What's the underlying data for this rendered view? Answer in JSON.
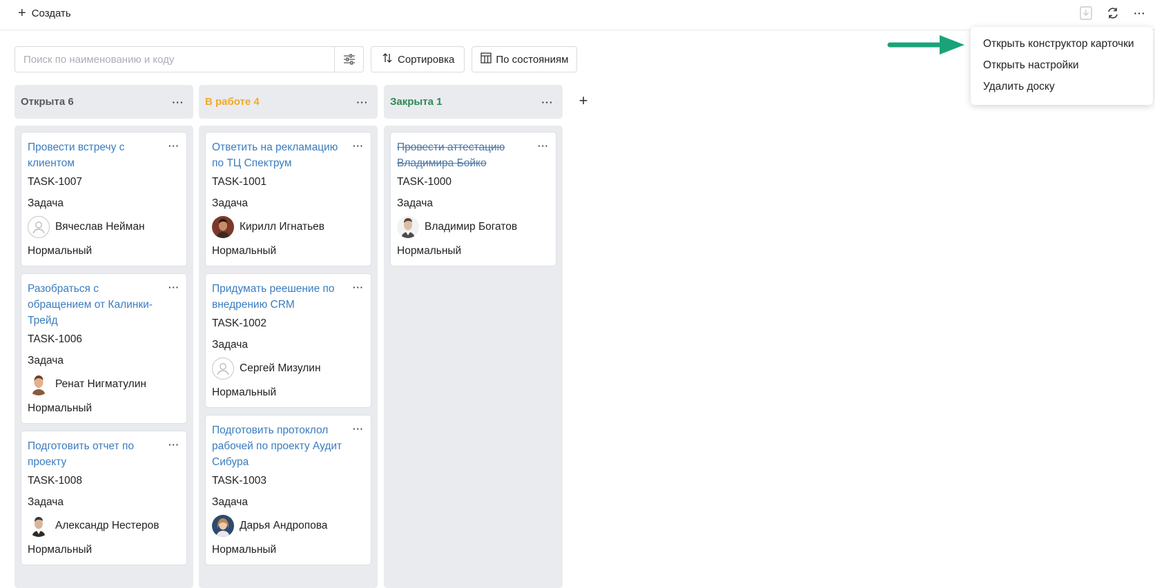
{
  "topbar": {
    "create_label": "Создать",
    "icons": [
      "download-icon",
      "refresh-icon",
      "more-icon"
    ]
  },
  "toolbar": {
    "search_placeholder": "Поиск по наименованию и коду",
    "sort_label": "Сортировка",
    "group_label": "По состояниям"
  },
  "columns": [
    {
      "title": "Открыта 6",
      "color": "#555a60",
      "cards": [
        {
          "title": "Провести встречу с клиентом",
          "code": "TASK-1007",
          "type": "Задача",
          "assignee": "Вячеслав Нейман",
          "avatar": "empty",
          "priority": "Нормальный"
        },
        {
          "title": "Разобраться с обращением от Калинки-Трейд",
          "code": "TASK-1006",
          "type": "Задача",
          "assignee": "Ренат Нигматулин",
          "avatar": "photo",
          "priority": "Нормальный"
        },
        {
          "title": "Подготовить отчет по проекту",
          "code": "TASK-1008",
          "type": "Задача",
          "assignee": "Александр Нестеров",
          "avatar": "photo",
          "priority": "Нормальный"
        }
      ]
    },
    {
      "title": "В работе 4",
      "color": "#f0a92b",
      "cards": [
        {
          "title": "Ответить на рекламацию по ТЦ Спектрум",
          "code": "TASK-1001",
          "type": "Задача",
          "assignee": "Кирилл Игнатьев",
          "avatar": "photo",
          "priority": "Нормальный"
        },
        {
          "title": "Придумать реешение по внедрению CRM",
          "code": "TASK-1002",
          "type": "Задача",
          "assignee": "Сергей Мизулин",
          "avatar": "empty",
          "priority": "Нормальный"
        },
        {
          "title": "Подготовить протоклол рабочей по проекту Аудит Сибура",
          "code": "TASK-1003",
          "type": "Задача",
          "assignee": "Дарья Андропова",
          "avatar": "photo",
          "priority": "Нормальный"
        }
      ]
    },
    {
      "title": "Закрыта 1",
      "color": "#2f8a55",
      "cards": [
        {
          "title": "Провести аттестацию Владимира Бойко",
          "code": "TASK-1000",
          "type": "Задача",
          "assignee": "Владимир Богатов",
          "avatar": "photo",
          "priority": "Нормальный",
          "done": true
        }
      ]
    }
  ],
  "menu": {
    "items": [
      "Открыть конструктор карточки",
      "Открыть настройки",
      "Удалить доску"
    ]
  },
  "colors": {
    "link": "#3a7cbf",
    "column_bg": "#e9ebee",
    "arrow": "#1aa37a"
  }
}
